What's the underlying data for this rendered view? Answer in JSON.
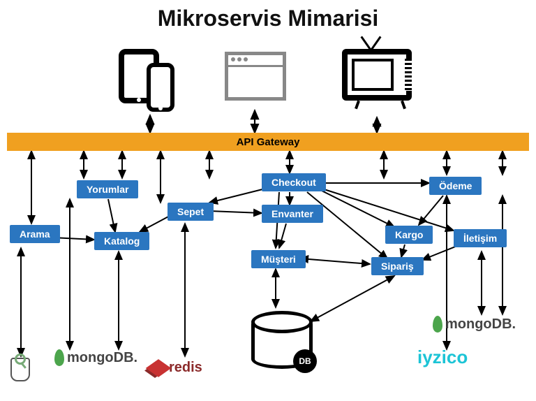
{
  "title": "Mikroservis Mimarisi",
  "gateway": "API Gateway",
  "clients": {
    "mobile": "mobile-devices",
    "browser": "web-browser",
    "tv": "television"
  },
  "services": {
    "arama": "Arama",
    "yorumlar": "Yorumlar",
    "katalog": "Katalog",
    "sepet": "Sepet",
    "checkout": "Checkout",
    "envanter": "Envanter",
    "musteri": "Müşteri",
    "siparis": "Sipariş",
    "kargo": "Kargo",
    "odeme": "Ödeme",
    "iletisim": "İletişim"
  },
  "datastores": {
    "db_label": "DB",
    "mongodb": "mongoDB.",
    "redis": "redis",
    "iyzico": "iyzico"
  }
}
